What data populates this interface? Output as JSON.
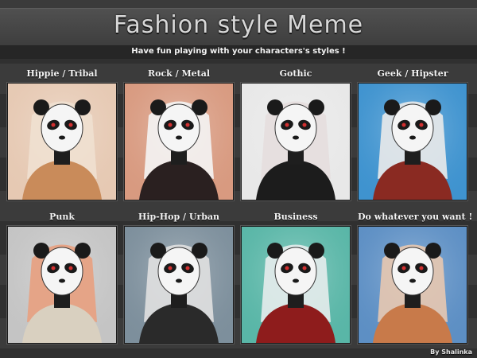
{
  "header": {
    "title": "Fashion style Meme",
    "subtitle": "Have fun playing with your characters's styles !"
  },
  "panels": [
    {
      "label": "Hippie / Tribal",
      "bg": "#e6c9b3"
    },
    {
      "label": "Rock / Metal",
      "bg": "#d89a80"
    },
    {
      "label": "Gothic",
      "bg": "#e8e8e8"
    },
    {
      "label": "Geek  / Hipster",
      "bg": "#3f93cf"
    },
    {
      "label": "Punk",
      "bg": "#c4c4c4"
    },
    {
      "label": "Hip-Hop / Urban",
      "bg": "#7d8f9c"
    },
    {
      "label": "Business",
      "bg": "#59b6a7"
    },
    {
      "label": "Do whatever you want !",
      "bg": "#5d8fc4"
    }
  ],
  "credit": "By Shalinka"
}
